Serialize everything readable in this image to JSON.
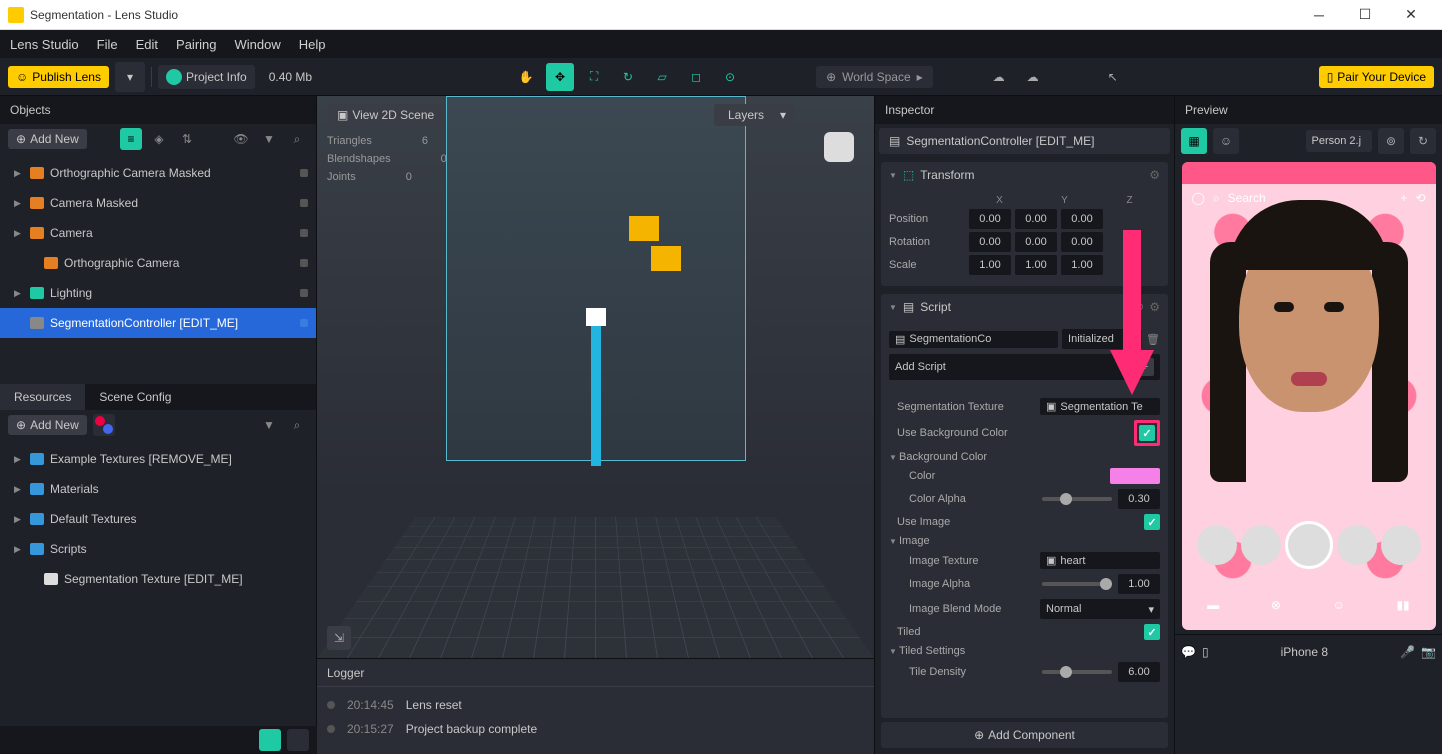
{
  "window": {
    "title": "Segmentation - Lens Studio"
  },
  "menu": [
    "Lens Studio",
    "File",
    "Edit",
    "Pairing",
    "Window",
    "Help"
  ],
  "toolbar": {
    "publish": "Publish Lens",
    "project_info": "Project Info",
    "size": "0.40 Mb",
    "world_space": "World Space",
    "pair": "Pair Your Device"
  },
  "objects": {
    "title": "Objects",
    "add_new": "Add New",
    "items": [
      {
        "label": "Orthographic Camera Masked",
        "icon": "cam",
        "expand": true
      },
      {
        "label": "Camera Masked",
        "icon": "cam",
        "expand": true
      },
      {
        "label": "Camera",
        "icon": "cam",
        "expand": true
      },
      {
        "label": "Orthographic Camera",
        "icon": "cam",
        "expand": false,
        "indent": 1
      },
      {
        "label": "Lighting",
        "icon": "light",
        "expand": true
      },
      {
        "label": "SegmentationController [EDIT_ME]",
        "icon": "script",
        "selected": true
      }
    ]
  },
  "resources": {
    "tabs": [
      "Resources",
      "Scene Config"
    ],
    "add_new": "Add New",
    "items": [
      {
        "label": "Example Textures [REMOVE_ME]",
        "icon": "folder",
        "expand": true
      },
      {
        "label": "Materials",
        "icon": "folder",
        "expand": true
      },
      {
        "label": "Default Textures",
        "icon": "folder",
        "expand": true
      },
      {
        "label": "Scripts",
        "icon": "folder",
        "expand": true
      },
      {
        "label": "Segmentation Texture [EDIT_ME]",
        "icon": "script",
        "indent": 1
      }
    ]
  },
  "viewport": {
    "view_2d": "View 2D Scene",
    "layers": "Layers",
    "stats": [
      {
        "k": "Triangles",
        "v": "6"
      },
      {
        "k": "Blendshapes",
        "v": "0"
      },
      {
        "k": "Joints",
        "v": "0"
      }
    ]
  },
  "logger": {
    "title": "Logger",
    "lines": [
      {
        "time": "20:14:45",
        "msg": "Lens reset"
      },
      {
        "time": "20:15:27",
        "msg": "Project backup complete"
      }
    ]
  },
  "inspector": {
    "title": "Inspector",
    "object": "SegmentationController [EDIT_ME]",
    "transform": {
      "title": "Transform",
      "axes": [
        "X",
        "Y",
        "Z"
      ],
      "rows": [
        {
          "label": "Position",
          "v": [
            "0.00",
            "0.00",
            "0.00"
          ]
        },
        {
          "label": "Rotation",
          "v": [
            "0.00",
            "0.00",
            "0.00"
          ]
        },
        {
          "label": "Scale",
          "v": [
            "1.00",
            "1.00",
            "1.00"
          ]
        }
      ]
    },
    "script": {
      "title": "Script",
      "ref": "SegmentationCo",
      "event": "Initialized",
      "add_script": "Add Script",
      "seg_tex_label": "Segmentation Texture",
      "seg_tex_value": "Segmentation Te",
      "use_bg_label": "Use Background Color",
      "bg_group": "Background Color",
      "color_label": "Color",
      "color_alpha_label": "Color Alpha",
      "color_alpha_value": "0.30",
      "use_image_label": "Use Image",
      "image_group": "Image",
      "image_tex_label": "Image Texture",
      "image_tex_value": "heart",
      "image_alpha_label": "Image Alpha",
      "image_alpha_value": "1.00",
      "blend_label": "Image Blend Mode",
      "blend_value": "Normal",
      "tiled_label": "Tiled",
      "tiled_group": "Tiled Settings",
      "tile_density_label": "Tile Density",
      "tile_density_value": "6.00"
    },
    "add_component": "Add Component"
  },
  "preview": {
    "title": "Preview",
    "source": "Person 2.j",
    "search": "Search",
    "device": "iPhone 8"
  }
}
